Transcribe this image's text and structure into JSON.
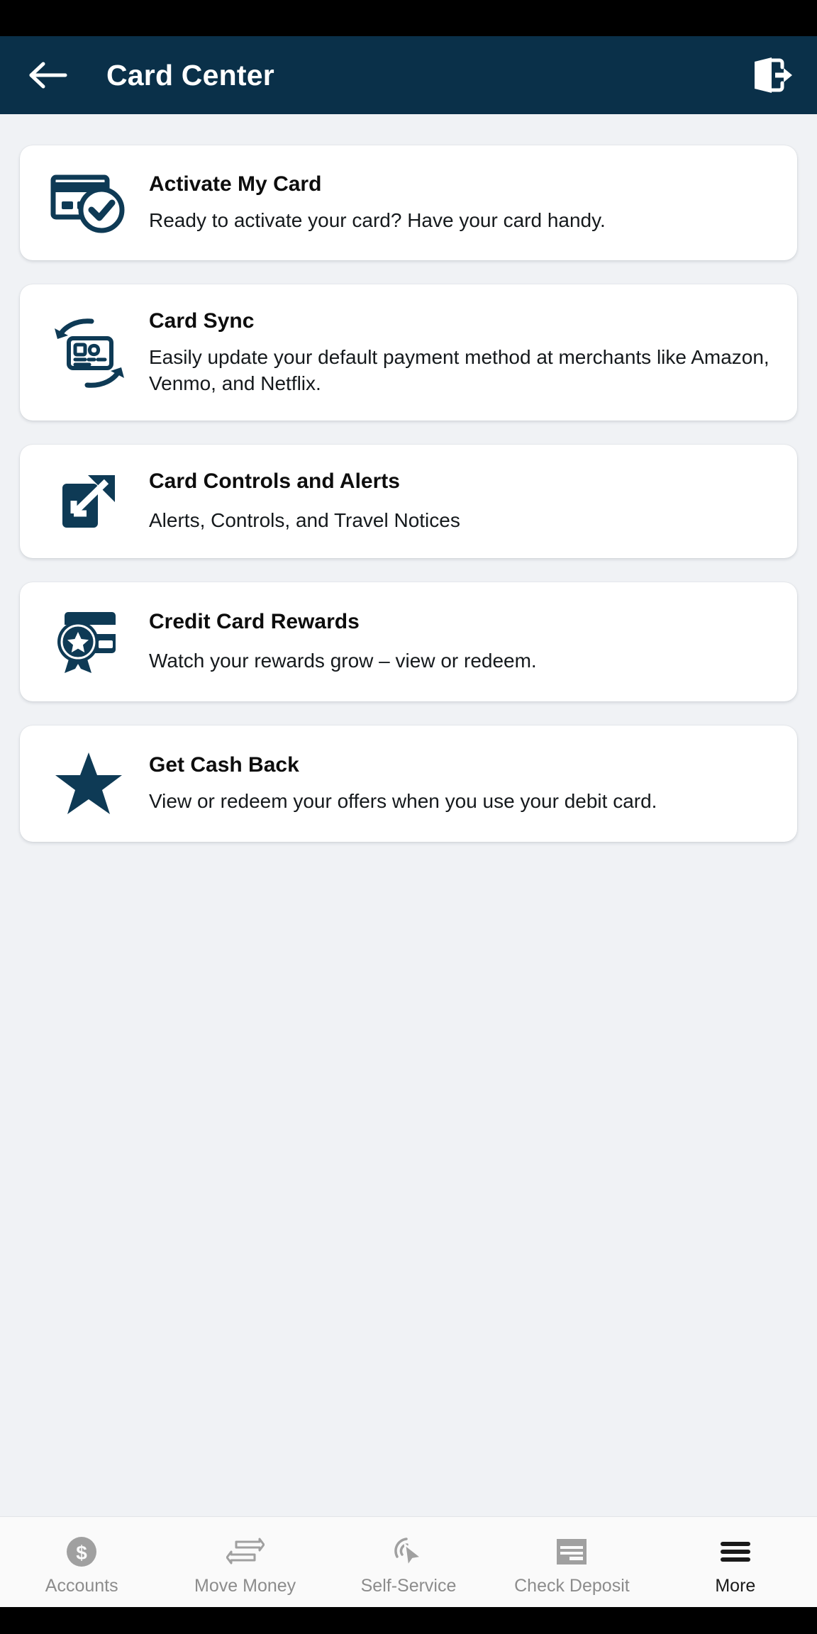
{
  "header": {
    "title": "Card Center",
    "back_icon": "back-arrow-icon",
    "logout_icon": "logout-icon",
    "bg_color": "#0A3049",
    "text_color": "#FFFFFF"
  },
  "theme": {
    "page_bg": "#F0F2F5",
    "card_bg": "#FFFFFF",
    "brand_navy": "#0A3049",
    "title_color": "#0D0D0D",
    "tab_inactive": "#8C8C8C",
    "tab_active": "#1A1A1A"
  },
  "main": {
    "items": [
      {
        "icon": "card-check-icon",
        "title": "Activate My Card",
        "desc": "Ready to activate your card? Have your card handy."
      },
      {
        "icon": "card-sync-icon",
        "title": "Card Sync",
        "desc": "Easily update your default payment method at merchants like Amazon, Venmo, and Netflix."
      },
      {
        "icon": "external-link-icon",
        "title": "Card Controls and Alerts",
        "desc": "Alerts, Controls, and Travel Notices"
      },
      {
        "icon": "card-award-icon",
        "title": "Credit Card Rewards",
        "desc": "Watch your rewards grow – view or redeem."
      },
      {
        "icon": "star-icon",
        "title": "Get Cash Back",
        "desc": "View or redeem your offers when you use your debit card."
      }
    ]
  },
  "tab_bar": {
    "items": [
      {
        "icon": "dollar-circle-icon",
        "label": "Accounts",
        "active": false
      },
      {
        "icon": "transfer-arrows-icon",
        "label": "Move Money",
        "active": false
      },
      {
        "icon": "target-cursor-icon",
        "label": "Self-Service",
        "active": false
      },
      {
        "icon": "check-deposit-icon",
        "label": "Check Deposit",
        "active": false
      },
      {
        "icon": "hamburger-menu-icon",
        "label": "More",
        "active": true
      }
    ]
  }
}
